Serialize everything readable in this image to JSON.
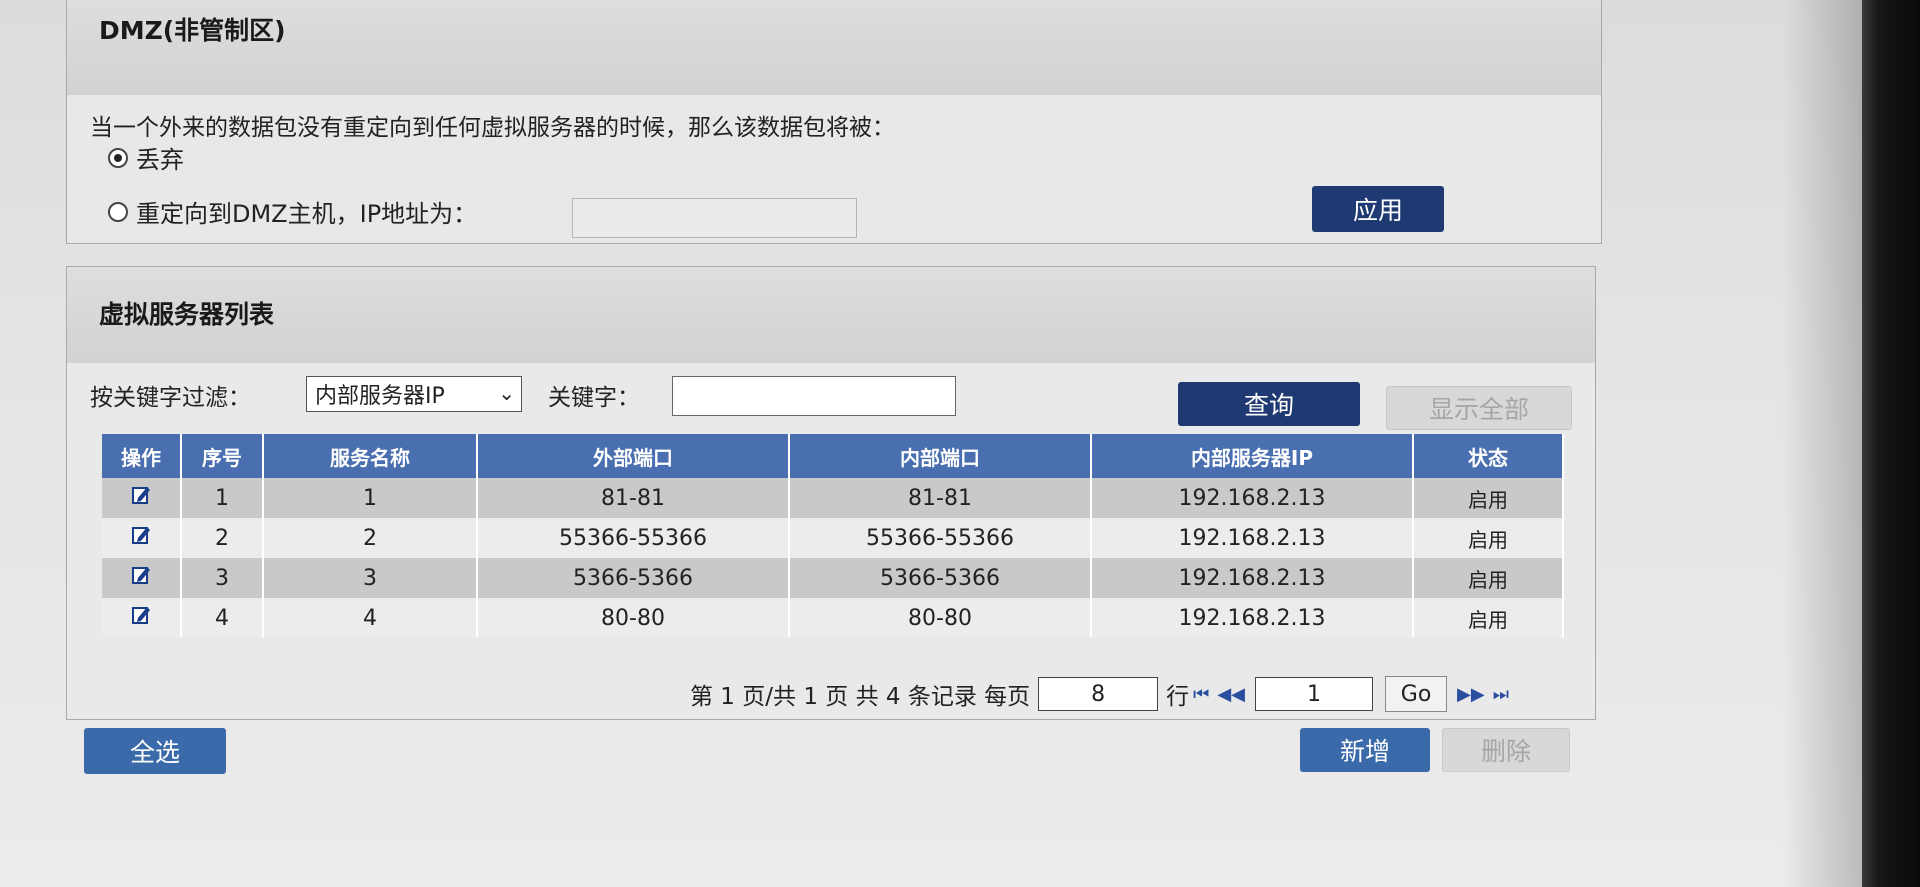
{
  "dmz": {
    "title": "DMZ(非管制区)",
    "description": "当一个外来的数据包没有重定向到任何虚拟服务器的时候，那么该数据包将被：",
    "option_drop": "丢弃",
    "option_redirect": "重定向到DMZ主机，IP地址为：",
    "ip_value": "",
    "apply_label": "应用"
  },
  "virtual_servers": {
    "title": "虚拟服务器列表",
    "filter_label": "按关键字过滤：",
    "filter_selected": "内部服务器IP",
    "keyword_label": "关键字：",
    "keyword_value": "",
    "query_label": "查询",
    "show_all_label": "显示全部",
    "columns": [
      "操作",
      "序号",
      "服务名称",
      "外部端口",
      "内部端口",
      "内部服务器IP",
      "状态"
    ],
    "rows": [
      {
        "seq": "1",
        "name": "1",
        "ext_port": "81-81",
        "int_port": "81-81",
        "ip": "192.168.2.13",
        "status": "启用"
      },
      {
        "seq": "2",
        "name": "2",
        "ext_port": "55366-55366",
        "int_port": "55366-55366",
        "ip": "192.168.2.13",
        "status": "启用"
      },
      {
        "seq": "3",
        "name": "3",
        "ext_port": "5366-5366",
        "int_port": "5366-5366",
        "ip": "192.168.2.13",
        "status": "启用"
      },
      {
        "seq": "4",
        "name": "4",
        "ext_port": "80-80",
        "int_port": "80-80",
        "ip": "192.168.2.13",
        "status": "启用"
      }
    ],
    "pagination": {
      "page_info": "第 1 页/共 1 页 共 4 条记录 每页",
      "per_page": "8",
      "rows_unit": "行",
      "page_input": "1",
      "go_label": "Go"
    },
    "select_all_label": "全选",
    "add_label": "新增",
    "delete_label": "删除"
  },
  "colors": {
    "header_blue": "#4a6fb0",
    "button_dark": "#1f3a72",
    "button_blue": "#3b6aaa"
  },
  "icons": {
    "edit": "edit-icon",
    "first": "first-page-icon",
    "prev": "prev-page-icon",
    "next": "next-page-icon",
    "last": "last-page-icon"
  }
}
